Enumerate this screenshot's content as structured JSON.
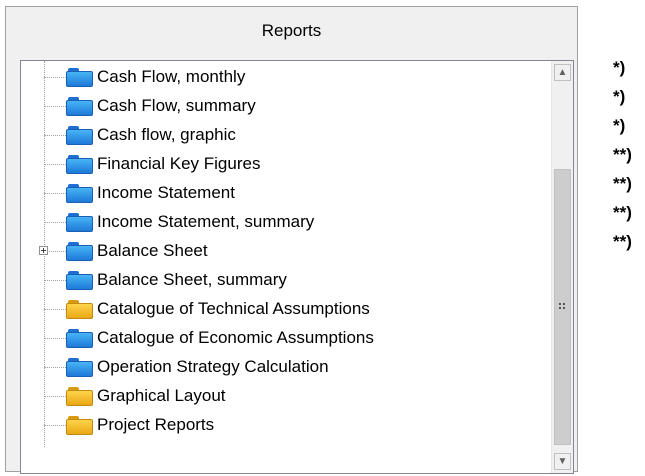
{
  "panel": {
    "title": "Reports"
  },
  "tree": {
    "items": [
      {
        "label": "Cash Flow, monthly",
        "icon": "folder-blue-icon",
        "expandable": false
      },
      {
        "label": "Cash Flow, summary",
        "icon": "folder-blue-icon",
        "expandable": false
      },
      {
        "label": "Cash flow, graphic",
        "icon": "folder-blue-icon",
        "expandable": false
      },
      {
        "label": "Financial Key Figures",
        "icon": "folder-blue-icon",
        "expandable": false
      },
      {
        "label": "Income Statement",
        "icon": "folder-blue-icon",
        "expandable": false
      },
      {
        "label": "Income Statement, summary",
        "icon": "folder-blue-icon",
        "expandable": false
      },
      {
        "label": "Balance Sheet",
        "icon": "folder-blue-icon",
        "expandable": true
      },
      {
        "label": "Balance Sheet, summary",
        "icon": "folder-blue-icon",
        "expandable": false
      },
      {
        "label": "Catalogue of Technical Assumptions",
        "icon": "folder-yellow-icon",
        "expandable": false
      },
      {
        "label": "Catalogue of Economic Assumptions",
        "icon": "folder-blue-icon",
        "expandable": false
      },
      {
        "label": "Operation Strategy Calculation",
        "icon": "folder-blue-icon",
        "expandable": false
      },
      {
        "label": "Graphical Layout",
        "icon": "folder-yellow-icon",
        "expandable": false
      },
      {
        "label": "Project Reports",
        "icon": "folder-yellow-icon",
        "expandable": false
      }
    ]
  },
  "notes": [
    "*)",
    "*)",
    "*)",
    "**)",
    "**)",
    "**)",
    "**)"
  ],
  "colors": {
    "folder_blue": "#2a8be6",
    "folder_yellow": "#f2bb2a"
  }
}
